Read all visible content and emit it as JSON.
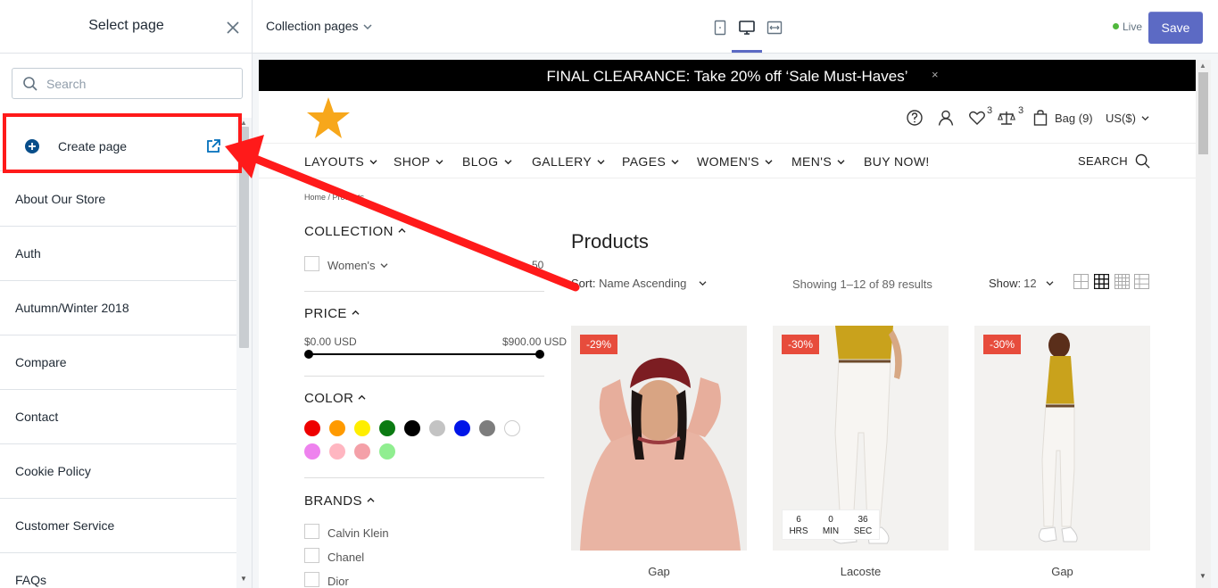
{
  "sidebar": {
    "title": "Select page",
    "search_placeholder": "Search",
    "create_label": "Create page",
    "pages": [
      {
        "label": "About Our Store"
      },
      {
        "label": "Auth"
      },
      {
        "label": "Autumn/Winter 2018"
      },
      {
        "label": "Compare"
      },
      {
        "label": "Contact"
      },
      {
        "label": "Cookie Policy"
      },
      {
        "label": "Customer Service"
      },
      {
        "label": "FAQs"
      }
    ]
  },
  "toolbar": {
    "page_selector": "Collection pages",
    "status": "Live",
    "save_label": "Save",
    "status_color": "#50b83c",
    "accent": "#5c6ac4"
  },
  "store": {
    "announcement": "FINAL CLEARANCE: Take 20% off ‘Sale Must-Haves’",
    "announcement_close": "×",
    "wishlist_count": "3",
    "compare_count": "3",
    "bag": "Bag (9)",
    "currency": "US($)",
    "nav": [
      "LAYOUTS",
      "SHOP",
      "BLOG",
      "GALLERY",
      "PAGES",
      "WOMEN'S",
      "MEN'S",
      "BUY NOW!"
    ],
    "search_label": "SEARCH",
    "breadcrumb": "Home  /  Products",
    "filters": {
      "collection_title": "COLLECTION",
      "collection_item": "Women's",
      "collection_count": "50",
      "price_title": "PRICE",
      "price_min": "$0.00 USD",
      "price_max": "$900.00 USD",
      "color_title": "COLOR",
      "colors": [
        "#ee0000",
        "#ff9a00",
        "#ffee00",
        "#0b7a12",
        "#000000",
        "#c3c3c3",
        "#0015e8",
        "#7d7d7d",
        "#ffffff",
        "#ee82ee",
        "#ffb6c1",
        "#f4a0a8",
        "#90ee90"
      ],
      "brands_title": "BRANDS",
      "brands": [
        "Calvin Klein",
        "Chanel",
        "Dior"
      ]
    },
    "products_title": "Products",
    "sort_label": "Sort:",
    "sort_value": "Name Ascending",
    "showing": "Showing 1–12 of 89 results",
    "show_label": "Show:",
    "show_value": "12",
    "products": [
      {
        "name": "Gap",
        "badge": "-29%"
      },
      {
        "name": "Lacoste",
        "badge": "-30%",
        "countdown": [
          {
            "num": "6",
            "unit": "HRS"
          },
          {
            "num": "0",
            "unit": "MIN"
          },
          {
            "num": "36",
            "unit": "SEC"
          }
        ]
      },
      {
        "name": "Gap",
        "badge": "-30%"
      }
    ]
  }
}
